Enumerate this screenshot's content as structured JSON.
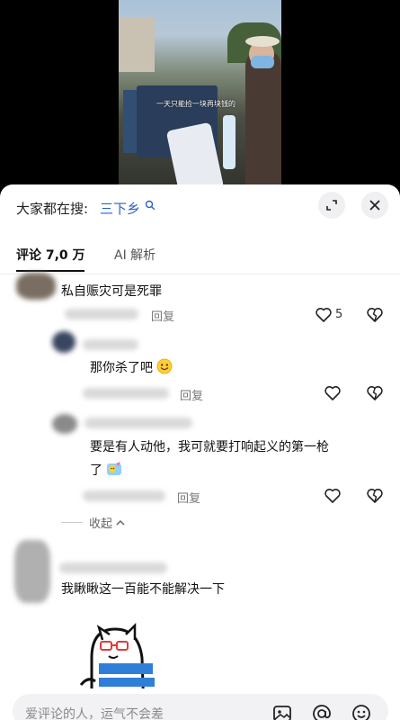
{
  "video": {
    "caption": "一天只能捡一块再块钱的"
  },
  "search": {
    "prefix": "大家都在搜:",
    "term": "三下乡"
  },
  "tabs": [
    {
      "label": "评论 7,0 万"
    },
    {
      "label": "AI 解析"
    }
  ],
  "comments": [
    {
      "text": "私自赈灾可是死罪",
      "reply_label": "回复",
      "likes": "5"
    },
    {
      "text": "那你杀了吧",
      "reply_label": "回复"
    },
    {
      "text_line1": "要是有人动他，我可就要打响起义的第一枪",
      "text_line2": "了",
      "reply_label": "回复"
    },
    {
      "text": "我瞅瞅这一百能不能解决一下"
    }
  ],
  "collapse_label": "收起",
  "input": {
    "placeholder": "爱评论的人，运气不会差"
  },
  "colors": {
    "link_blue": "#2a63c6",
    "sheet_bg": "#ffffff"
  },
  "icons": [
    "search-icon",
    "expand-icon",
    "close-icon",
    "heart-icon",
    "dislike-icon",
    "image-icon",
    "at-icon",
    "emoji-icon"
  ]
}
